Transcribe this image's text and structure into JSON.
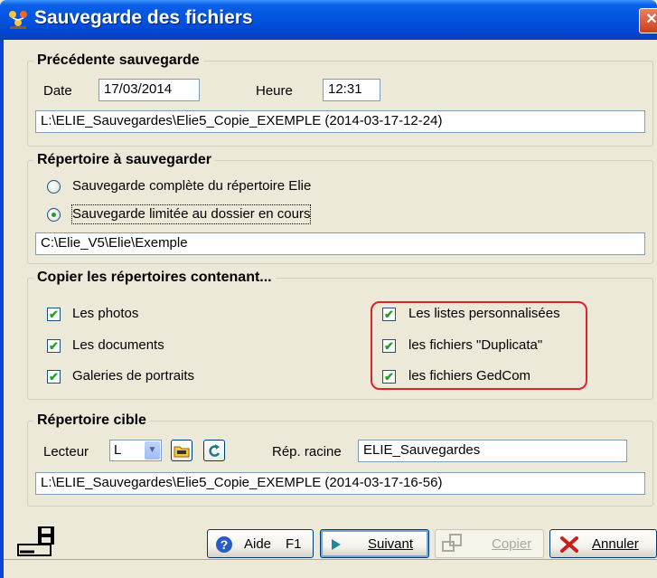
{
  "window": {
    "title": "Sauvegarde des fichiers",
    "close_glyph": "✕"
  },
  "previous_backup": {
    "legend": "Précédente sauvegarde",
    "date_label": "Date",
    "date_value": "17/03/2014",
    "time_label": "Heure",
    "time_value": "12:31",
    "path": "L:\\ELIE_Sauvegardes\\Elie5_Copie_EXEMPLE (2014-03-17-12-24)"
  },
  "source_dir": {
    "legend": "Répertoire à sauvegarder",
    "options": [
      {
        "label": "Sauvegarde complète du répertoire Elie",
        "selected": false
      },
      {
        "label": "Sauvegarde limitée au dossier en cours",
        "selected": true
      }
    ],
    "path": "C:\\Elie_V5\\Elie\\Exemple"
  },
  "copy_dirs": {
    "legend": "Copier les répertoires contenant...",
    "left": [
      {
        "label": "Les photos",
        "checked": true
      },
      {
        "label": "Les documents",
        "checked": true
      },
      {
        "label": "Galeries de portraits",
        "checked": true
      }
    ],
    "right": [
      {
        "label": "Les listes personnalisées",
        "checked": true
      },
      {
        "label": "les fichiers \"Duplicata\"",
        "checked": true
      },
      {
        "label": "les fichiers GedCom",
        "checked": true
      }
    ],
    "highlight_color": "#E0222A"
  },
  "target_dir": {
    "legend": "Répertoire cible",
    "drive_label": "Lecteur",
    "drive_value": "L",
    "root_label": "Rép. racine",
    "root_value": "ELIE_Sauvegardes",
    "path": "L:\\ELIE_Sauvegardes\\Elie5_Copie_EXEMPLE (2014-03-17-16-56)"
  },
  "buttons": {
    "help_label": "Aide",
    "help_key": "F1",
    "next_label": "Suivant",
    "copy_label": "Copier",
    "cancel_label": "Annuler"
  },
  "colors": {
    "titlebar": "#0256DD",
    "dialog_bg": "#ECE9D8",
    "check": "#21A121"
  },
  "icons": {
    "app": "family-tree-icon",
    "backup": "disk-backup-icon",
    "folder": "folder-icon",
    "refresh": "refresh-icon",
    "help": "help-icon",
    "next": "play-arrow-icon",
    "copy": "copy-disk-icon",
    "cancel": "red-x-icon"
  }
}
